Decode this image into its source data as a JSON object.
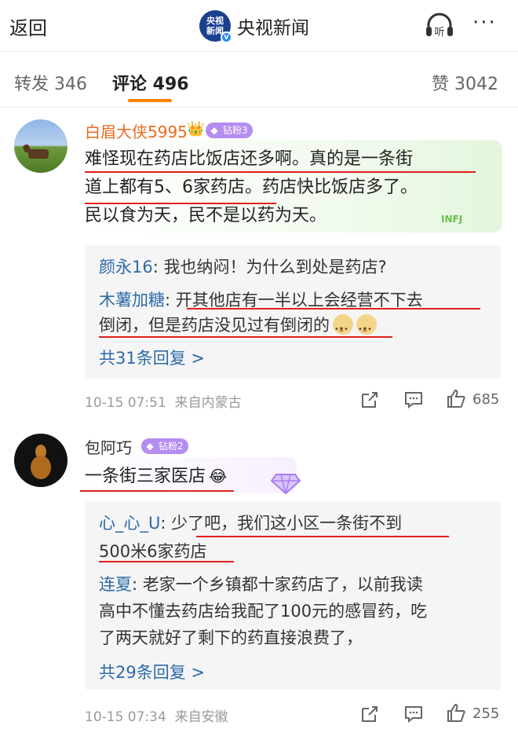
{
  "header": {
    "back_label": "返回",
    "logo_text": "央视新闻",
    "account_name": "央视新闻",
    "listen_label": "听",
    "more_label": "···"
  },
  "tabs": [
    {
      "label": "转发 346"
    },
    {
      "label": "评论 496"
    },
    {
      "label": "赞 3042"
    }
  ],
  "accent_color": "#ff8200",
  "comments": [
    {
      "username": "白眉大侠5995",
      "badge": "钻粉3",
      "text_lines": [
        "难怪现在药店比饭店还多啊。真的是一条街",
        "道上都有5、6家药店。药店快比饭店多了。",
        "民以食为天，民不是以药为天。"
      ],
      "replies": [
        {
          "name": "颜永16",
          "text_lines": [
            "我也纳闷！为什么到处是药店?"
          ]
        },
        {
          "name": "木薯加糖",
          "text_lines": [
            "开其他店有一半以上会经营不下去",
            "倒闭，但是药店没见过有倒闭的"
          ]
        }
      ],
      "more_replies": "共31条回复 >",
      "time": "10-15 07:51",
      "location": "来自内蒙古",
      "likes": "685"
    },
    {
      "username": "包阿巧",
      "badge": "钻粉2",
      "text_lines": [
        "一条街三家医店"
      ],
      "replies": [
        {
          "name": "心_心_U",
          "text_lines": [
            "少了吧，我们这小区一条街不到",
            "500米6家药店"
          ]
        },
        {
          "name": "连夏",
          "text_lines": [
            "老家一个乡镇都十家药店了，以前我读",
            "高中不懂去药店给我配了100元的感冒药，吃",
            "了两天就好了剩下的药直接浪费了，"
          ]
        }
      ],
      "more_replies": "共29条回复 >",
      "time": "10-15 07:34",
      "location": "来自安徽",
      "likes": "255"
    }
  ],
  "sticker_text": "INFJ"
}
